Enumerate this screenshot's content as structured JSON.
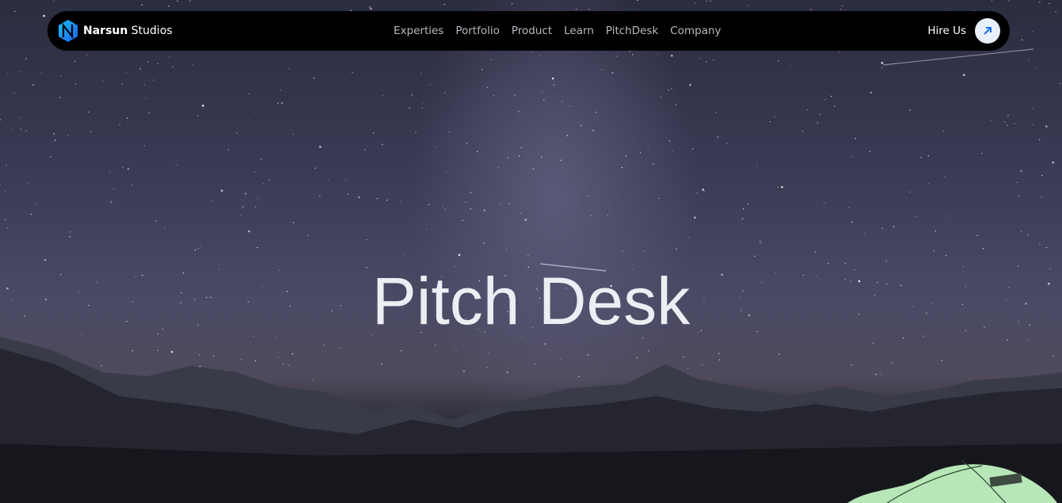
{
  "nav": {
    "brand_bold": "Narsun",
    "brand_rest": "Studios",
    "links": [
      "Experties",
      "Portfolio",
      "Product",
      "Learn",
      "PitchDesk",
      "Company"
    ],
    "hire_label": "Hire Us",
    "hire_icon": "arrow-up-right-icon"
  },
  "hero": {
    "title": "Pitch Desk"
  },
  "colors": {
    "accent": "#1aa3f0",
    "nav_bg": "#000000",
    "hire_btn_bg": "#e8f0fb"
  }
}
